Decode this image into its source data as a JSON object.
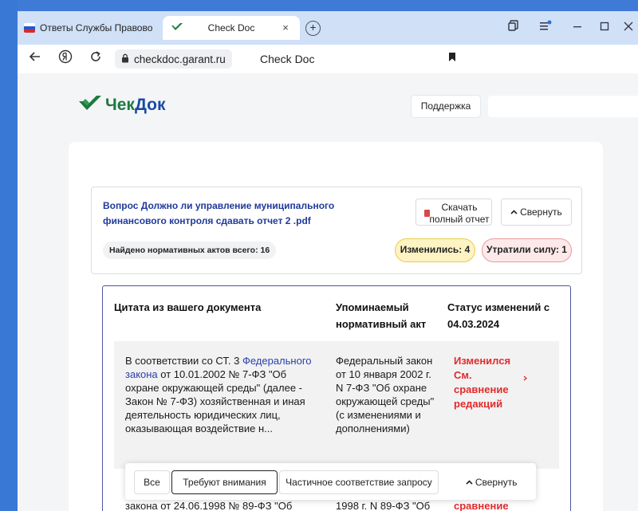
{
  "browser": {
    "tabs": [
      {
        "title": "Ответы Службы Правово",
        "active": false
      },
      {
        "title": "Check Doc",
        "active": true
      }
    ],
    "tab_close": "×",
    "new_tab": "+",
    "url": "checkdoc.garant.ru",
    "page_title": "Check Doc"
  },
  "header": {
    "logo_part1": "Чек",
    "logo_part2": "Док",
    "support_label": "Поддержка"
  },
  "summary": {
    "document_title": "Вопрос Должно ли управление муниципального финансового контроля сдавать отчет 2 .pdf",
    "found_label": "Найдено нормативных актов всего: 16",
    "download_label": "Скачать полный отчет",
    "collapse_label": "Свернуть",
    "changed_label": "Изменились: 4",
    "lost_label": "Утратили силу: 1"
  },
  "table": {
    "col_quote": "Цитата из вашего документа",
    "col_act": "Упоминаемый нормативный акт",
    "col_status": "Статус изменений с 04.03.2024",
    "rows": [
      {
        "quote_prefix": "В соответствии со СТ. 3",
        "quote_link": "Федерального закона",
        "quote_suffix": "от 10.01.2002 № 7-ФЗ \"Об охране окружающей среды\" (далее - Закон № 7-ФЗ) хозяйственная и иная деятельность юридических лиц, оказывающая воздействие н...",
        "act": "Федеральный закон от 10 января 2002 г. N 7-ФЗ \"Об охране окружающей среды\" (с изменениями и дополнениями)",
        "status": "Изменился См. сравнение редакций"
      },
      {
        "quote_partial": "закона от 24.06.1998 № 89-ФЗ \"Об",
        "act_partial": "1998 г. N 89-ФЗ \"Об",
        "status_partial": "сравнение"
      }
    ]
  },
  "filters": {
    "all": "Все",
    "attention": "Требуют внимания",
    "partial": "Частичное соответствие запросу",
    "collapse": "Свернуть"
  },
  "colors": {
    "brand_green": "#1d7a3f",
    "brand_blue": "#1a4aa0",
    "link_blue": "#2a3fa8",
    "status_red": "#e22b2b",
    "changed_yellow": "#fdf3c3",
    "lost_pink": "#fde9ea"
  },
  "icons": [
    "back-arrow-icon",
    "yandex-icon",
    "reload-icon",
    "lock-icon",
    "bookmark-icon",
    "collections-icon",
    "menu-icon",
    "minimize-icon",
    "maximize-icon",
    "close-window-icon",
    "pdf-icon",
    "chevron-up-icon",
    "arrow-right-icon"
  ]
}
